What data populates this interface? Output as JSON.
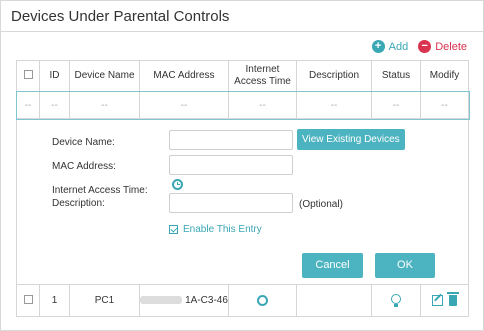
{
  "panel": {
    "title": "Devices Under Parental Controls"
  },
  "toolbar": {
    "add_label": "Add",
    "delete_label": "Delete",
    "add_symbol": "+",
    "delete_symbol": "−"
  },
  "table": {
    "headers": [
      "",
      "ID",
      "Device Name",
      "MAC Address",
      "Internet Access Time",
      "Description",
      "Status",
      "Modify"
    ],
    "placeholder_row": [
      "--",
      "--",
      "--",
      "--",
      "--",
      "--",
      "--",
      "--"
    ],
    "rows": [
      {
        "id": "1",
        "device_name": "PC1",
        "mac_visible_suffix": "1A-C3-46",
        "description": ""
      }
    ]
  },
  "form": {
    "device_name_label": "Device Name:",
    "mac_label": "MAC Address:",
    "access_time_label": "Internet Access Time:",
    "description_label": "Description:",
    "device_name_value": "",
    "mac_value": "",
    "description_value": "",
    "view_devices_label": "View Existing Devices",
    "optional_label": "(Optional)",
    "enable_label": "Enable This Entry",
    "enable_checked": true,
    "cancel_label": "Cancel",
    "ok_label": "OK"
  },
  "colors": {
    "accent": "#3aa7b4",
    "button": "#4cb3c0",
    "danger": "#d9334f"
  }
}
